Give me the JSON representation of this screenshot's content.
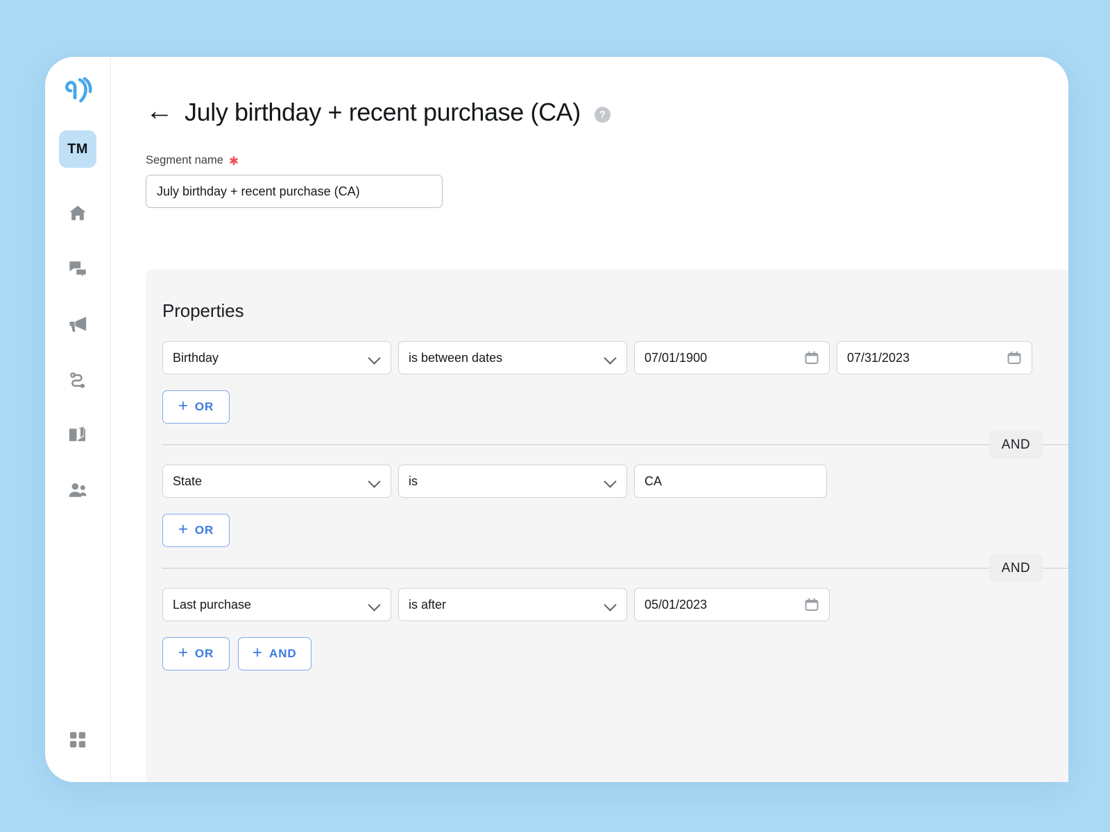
{
  "background_color": "#a9d9f5",
  "accent_color": "#3a7ae0",
  "sidebar": {
    "logo_name": "brand-wave-logo",
    "workspace_initials": "TM",
    "items": [
      {
        "name": "home-icon",
        "label": "Home"
      },
      {
        "name": "conversations-icon",
        "label": "Conversations"
      },
      {
        "name": "campaigns-megaphone-icon",
        "label": "Campaigns"
      },
      {
        "name": "workflows-icon",
        "label": "Workflows"
      },
      {
        "name": "knowledge-book-icon",
        "label": "Knowledge"
      },
      {
        "name": "contacts-people-icon",
        "label": "Contacts"
      }
    ],
    "bottom_item": {
      "name": "apps-grid-icon",
      "label": "Apps"
    }
  },
  "header": {
    "back_arrow": "←",
    "title": "July birthday + recent purchase (CA)",
    "help_glyph": "?"
  },
  "segment_name_field": {
    "label": "Segment name",
    "required_marker": "✱",
    "value": "July birthday + recent purchase (CA)",
    "placeholder": "Segment name"
  },
  "properties_panel": {
    "title": "Properties",
    "groups": [
      {
        "conditions": [
          {
            "attribute": "Birthday",
            "operator": "is between dates",
            "values": [
              {
                "type": "date",
                "value": "07/01/1900"
              },
              {
                "type": "date",
                "value": "07/31/2023"
              }
            ]
          }
        ],
        "add_buttons": [
          {
            "plus": "+",
            "label": "OR"
          }
        ]
      },
      {
        "conditions": [
          {
            "attribute": "State",
            "operator": "is",
            "values": [
              {
                "type": "text",
                "value": "CA"
              }
            ]
          }
        ],
        "add_buttons": [
          {
            "plus": "+",
            "label": "OR"
          }
        ]
      },
      {
        "conditions": [
          {
            "attribute": "Last purchase",
            "operator": "is after",
            "values": [
              {
                "type": "date",
                "value": "05/01/2023"
              }
            ]
          }
        ],
        "add_buttons": [
          {
            "plus": "+",
            "label": "OR"
          },
          {
            "plus": "+",
            "label": "AND"
          }
        ]
      }
    ],
    "joiners": [
      "AND",
      "AND"
    ]
  }
}
